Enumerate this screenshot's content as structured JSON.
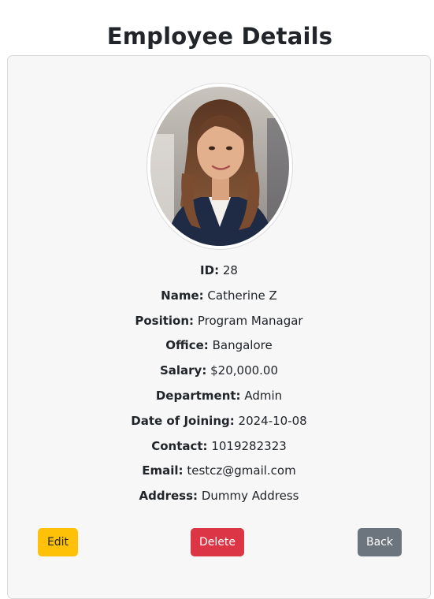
{
  "page": {
    "title": "Employee Details"
  },
  "employee": {
    "photo_alt": "Employee photo",
    "fields": [
      {
        "label": "ID:",
        "value": "28"
      },
      {
        "label": "Name:",
        "value": "Catherine Z"
      },
      {
        "label": "Position:",
        "value": "Program Managar"
      },
      {
        "label": "Office:",
        "value": "Bangalore"
      },
      {
        "label": "Salary:",
        "value": "$20,000.00"
      },
      {
        "label": "Department:",
        "value": "Admin"
      },
      {
        "label": "Date of Joining:",
        "value": "2024-10-08"
      },
      {
        "label": "Contact:",
        "value": "1019282323"
      },
      {
        "label": "Email:",
        "value": "testcz@gmail.com"
      },
      {
        "label": "Address:",
        "value": "Dummy Address"
      }
    ]
  },
  "actions": {
    "edit_label": "Edit",
    "delete_label": "Delete",
    "back_label": "Back"
  },
  "colors": {
    "edit": "#ffc107",
    "delete": "#dc3545",
    "back": "#6c757d",
    "card_bg": "#f7f7f7"
  }
}
